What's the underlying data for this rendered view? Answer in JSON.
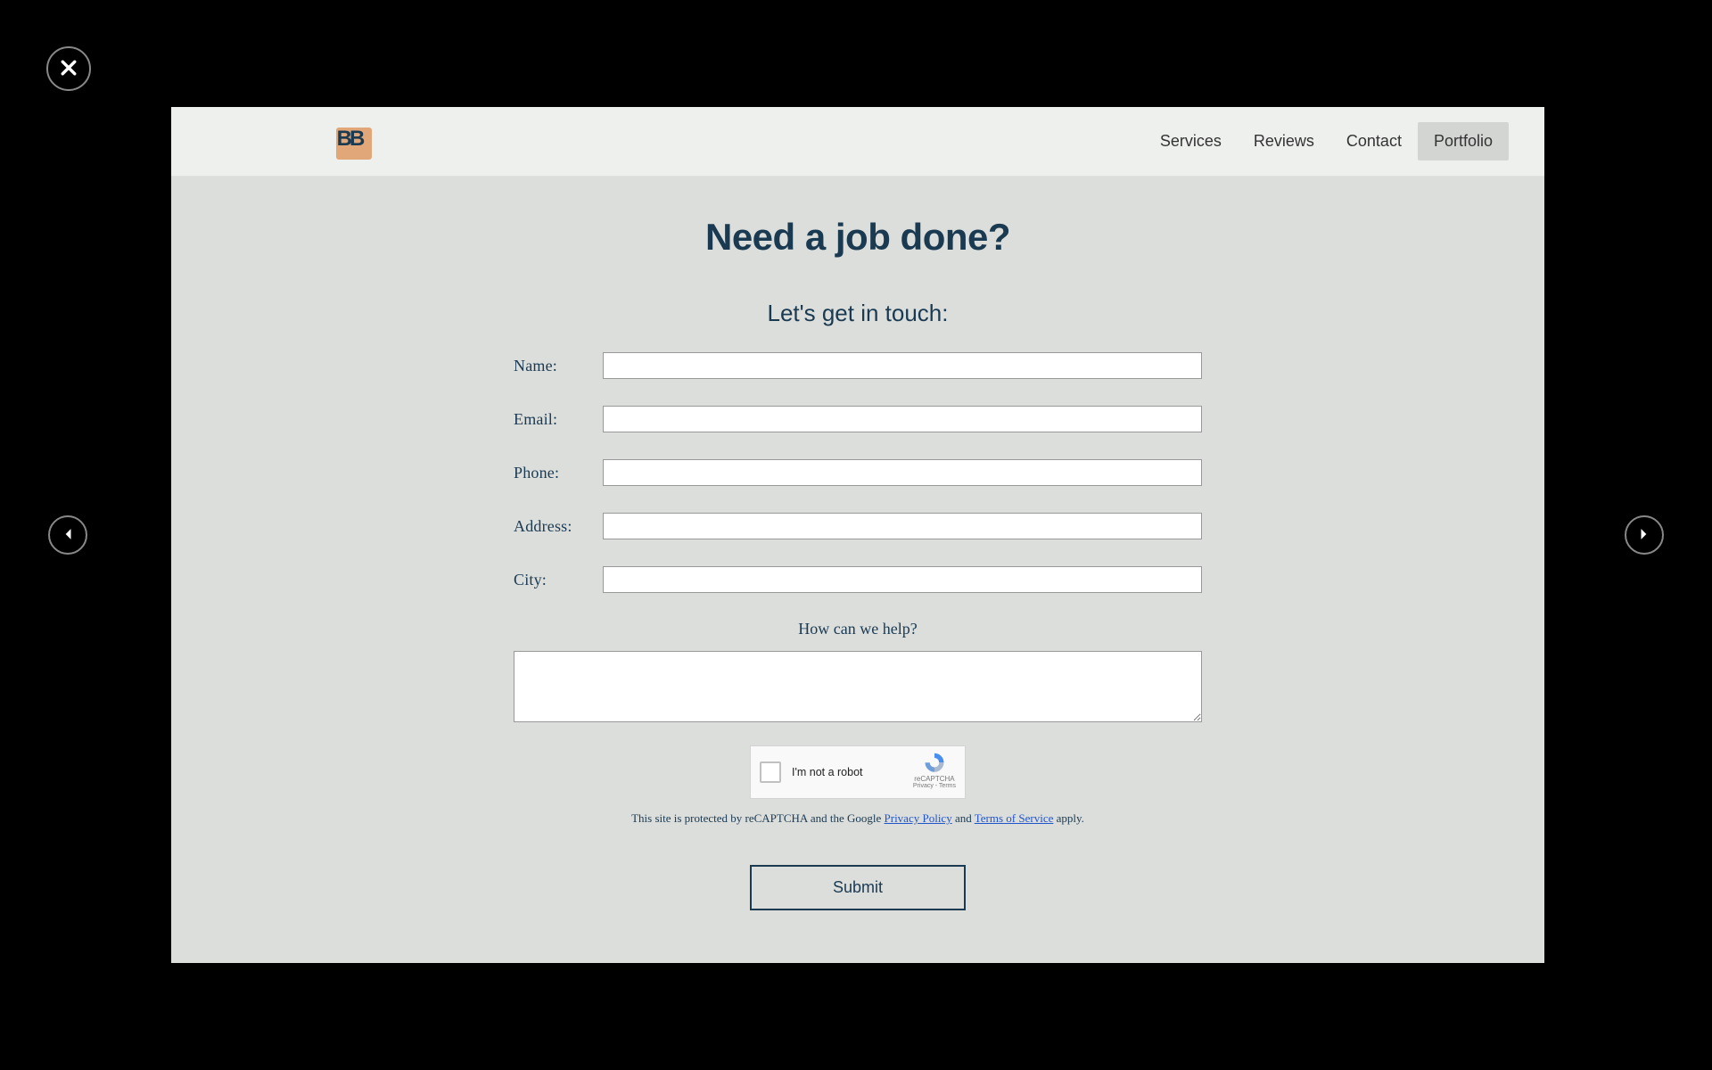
{
  "nav": {
    "links": [
      "Services",
      "Reviews",
      "Contact",
      "Portfolio"
    ],
    "active_index": 3
  },
  "heading": "Need a job done?",
  "subheading": "Let's get in touch:",
  "form": {
    "labels": {
      "name": "Name:",
      "email": "Email:",
      "phone": "Phone:",
      "address": "Address:",
      "city": "City:",
      "help": "How can we help?"
    },
    "values": {
      "name": "",
      "email": "",
      "phone": "",
      "address": "",
      "city": "",
      "help": ""
    }
  },
  "recaptcha": {
    "label": "I'm not a robot",
    "brand": "reCAPTCHA",
    "links": "Privacy - Terms"
  },
  "disclaimer": {
    "pre": "This site is protected by reCAPTCHA and the Google ",
    "privacy": "Privacy Policy",
    "mid": " and ",
    "terms": "Terms of Service",
    "post": " apply."
  },
  "submit_label": "Submit"
}
